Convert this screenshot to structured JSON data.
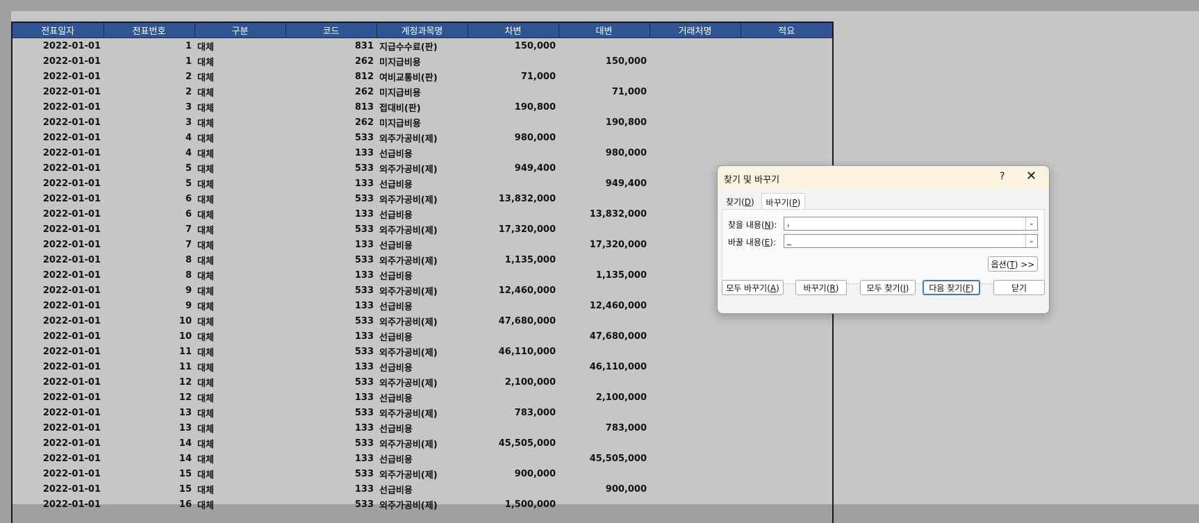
{
  "table": {
    "headers": [
      "전표일자",
      "전표번호",
      "구분",
      "코드",
      "계정과목명",
      "차변",
      "대변",
      "거래처명",
      "적요"
    ],
    "rows": [
      [
        "2022-01-01",
        "1",
        "대체",
        "831",
        "지급수수료(판)",
        "150,000",
        ""
      ],
      [
        "2022-01-01",
        "1",
        "대체",
        "262",
        "미지급비용",
        "",
        "150,000"
      ],
      [
        "2022-01-01",
        "2",
        "대체",
        "812",
        "여비교통비(판)",
        "71,000",
        ""
      ],
      [
        "2022-01-01",
        "2",
        "대체",
        "262",
        "미지급비용",
        "",
        "71,000"
      ],
      [
        "2022-01-01",
        "3",
        "대체",
        "813",
        "접대비(판)",
        "190,800",
        ""
      ],
      [
        "2022-01-01",
        "3",
        "대체",
        "262",
        "미지급비용",
        "",
        "190,800"
      ],
      [
        "2022-01-01",
        "4",
        "대체",
        "533",
        "외주가공비(제)",
        "980,000",
        ""
      ],
      [
        "2022-01-01",
        "4",
        "대체",
        "133",
        "선급비용",
        "",
        "980,000"
      ],
      [
        "2022-01-01",
        "5",
        "대체",
        "533",
        "외주가공비(제)",
        "949,400",
        ""
      ],
      [
        "2022-01-01",
        "5",
        "대체",
        "133",
        "선급비용",
        "",
        "949,400"
      ],
      [
        "2022-01-01",
        "6",
        "대체",
        "533",
        "외주가공비(제)",
        "13,832,000",
        ""
      ],
      [
        "2022-01-01",
        "6",
        "대체",
        "133",
        "선급비용",
        "",
        "13,832,000"
      ],
      [
        "2022-01-01",
        "7",
        "대체",
        "533",
        "외주가공비(제)",
        "17,320,000",
        ""
      ],
      [
        "2022-01-01",
        "7",
        "대체",
        "133",
        "선급비용",
        "",
        "17,320,000"
      ],
      [
        "2022-01-01",
        "8",
        "대체",
        "533",
        "외주가공비(제)",
        "1,135,000",
        ""
      ],
      [
        "2022-01-01",
        "8",
        "대체",
        "133",
        "선급비용",
        "",
        "1,135,000"
      ],
      [
        "2022-01-01",
        "9",
        "대체",
        "533",
        "외주가공비(제)",
        "12,460,000",
        ""
      ],
      [
        "2022-01-01",
        "9",
        "대체",
        "133",
        "선급비용",
        "",
        "12,460,000"
      ],
      [
        "2022-01-01",
        "10",
        "대체",
        "533",
        "외주가공비(제)",
        "47,680,000",
        ""
      ],
      [
        "2022-01-01",
        "10",
        "대체",
        "133",
        "선급비용",
        "",
        "47,680,000"
      ],
      [
        "2022-01-01",
        "11",
        "대체",
        "533",
        "외주가공비(제)",
        "46,110,000",
        ""
      ],
      [
        "2022-01-01",
        "11",
        "대체",
        "133",
        "선급비용",
        "",
        "46,110,000"
      ],
      [
        "2022-01-01",
        "12",
        "대체",
        "533",
        "외주가공비(제)",
        "2,100,000",
        ""
      ],
      [
        "2022-01-01",
        "12",
        "대체",
        "133",
        "선급비용",
        "",
        "2,100,000"
      ],
      [
        "2022-01-01",
        "13",
        "대체",
        "533",
        "외주가공비(제)",
        "783,000",
        ""
      ],
      [
        "2022-01-01",
        "13",
        "대체",
        "133",
        "선급비용",
        "",
        "783,000"
      ],
      [
        "2022-01-01",
        "14",
        "대체",
        "533",
        "외주가공비(제)",
        "45,505,000",
        ""
      ],
      [
        "2022-01-01",
        "14",
        "대체",
        "133",
        "선급비용",
        "",
        "45,505,000"
      ],
      [
        "2022-01-01",
        "15",
        "대체",
        "533",
        "외주가공비(제)",
        "900,000",
        ""
      ],
      [
        "2022-01-01",
        "15",
        "대체",
        "133",
        "선급비용",
        "",
        "900,000"
      ],
      [
        "2022-01-01",
        "16",
        "대체",
        "533",
        "외주가공비(제)",
        "1,500,000",
        ""
      ]
    ]
  },
  "dialog": {
    "title": "찾기 및 바꾸기",
    "help": "?",
    "close": "✕",
    "tab_find": "찾기(",
    "tab_find_key": "D",
    "tab_replace": "바꾸기(",
    "tab_replace_key": "P",
    "find_label": "찾을 내용(",
    "find_key": "N",
    "find_value": ",",
    "replace_label": "바꿀 내용(",
    "replace_key": "E",
    "replace_value": "_",
    "options": "옵션(",
    "options_key": "T",
    "options_suffix": ") >>",
    "replace_all": "모두 바꾸기(",
    "replace_all_key": "A",
    "replace": "바꾸기(",
    "replace_key_btn": "R",
    "find_all": "모두 찾기(",
    "find_all_key": "I",
    "find_next": "다음 찾기(",
    "find_next_key": "F",
    "close_btn": "닫기",
    "paren": "):"
  },
  "colors": {
    "header_bg": "#2f5597",
    "sheet_bg": "#c6c6c6",
    "dialog_title_bg": "#fbf3e0"
  }
}
